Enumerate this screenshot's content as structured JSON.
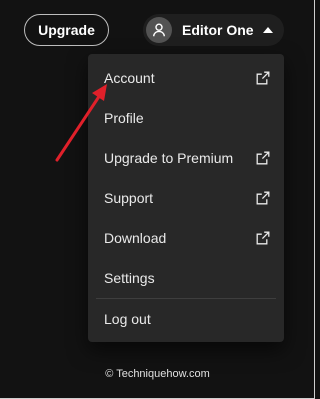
{
  "header": {
    "upgrade_label": "Upgrade",
    "user_name": "Editor One",
    "avatar_icon": "user-icon",
    "caret_icon": "caret-up-icon"
  },
  "menu": {
    "items": [
      {
        "label": "Account",
        "external": true
      },
      {
        "label": "Profile",
        "external": false
      },
      {
        "label": "Upgrade to Premium",
        "external": true
      },
      {
        "label": "Support",
        "external": true
      },
      {
        "label": "Download",
        "external": true
      },
      {
        "label": "Settings",
        "external": false
      }
    ],
    "logout_label": "Log out",
    "external_icon": "external-link-icon"
  },
  "watermark": "© Techniquehow.com",
  "colors": {
    "background": "#121212",
    "menu_background": "#282828",
    "annotation_arrow": "#e0202a"
  }
}
